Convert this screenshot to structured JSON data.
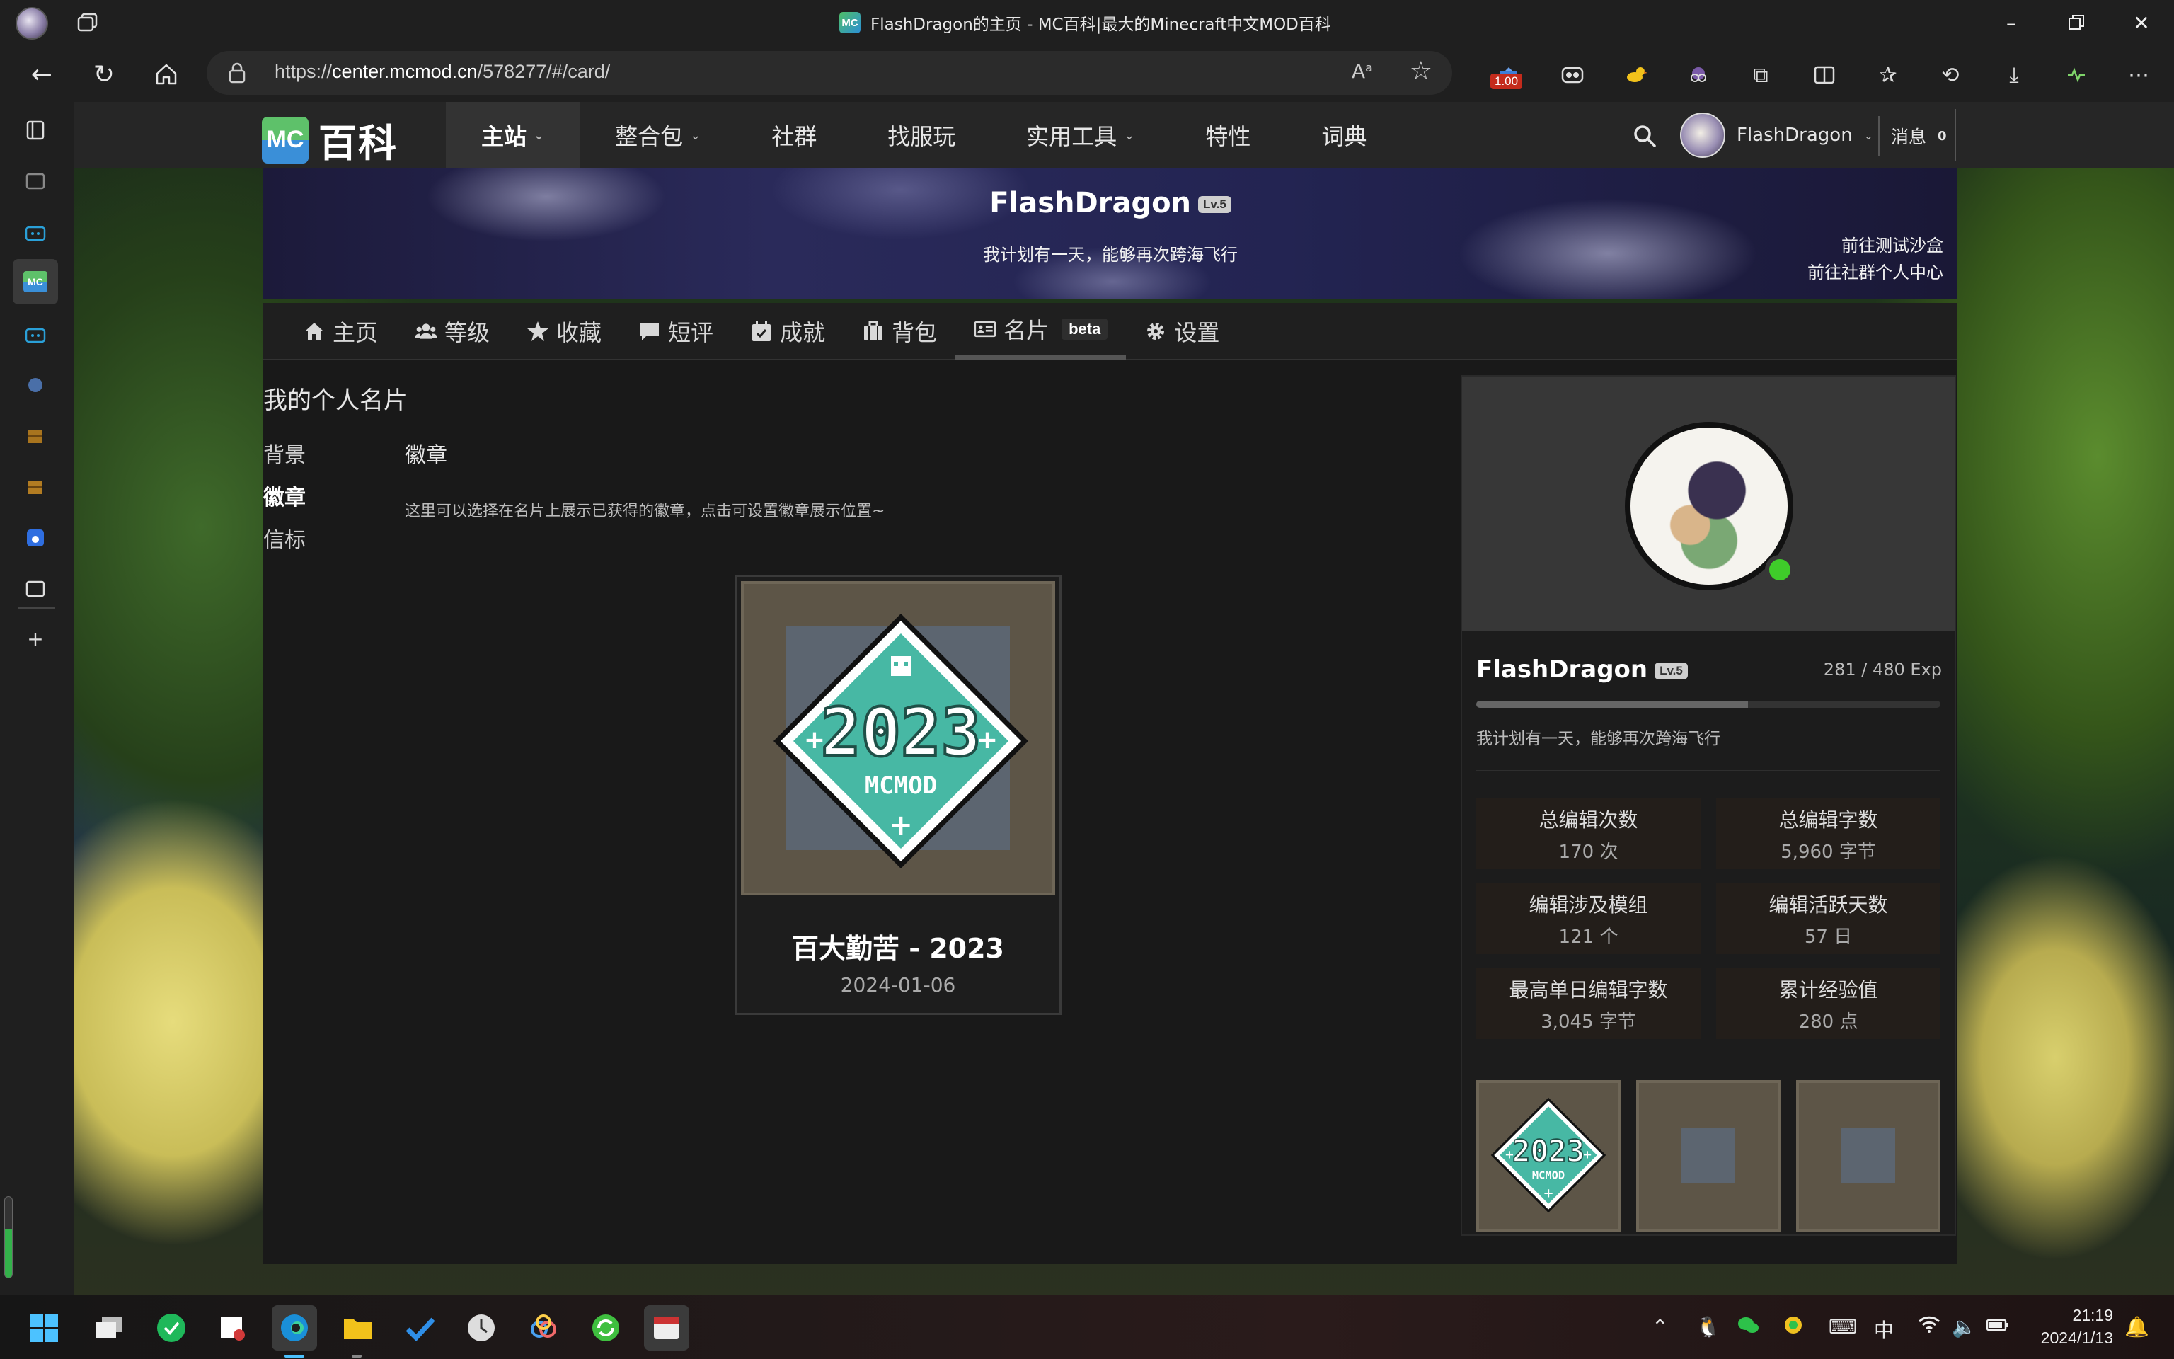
{
  "browser": {
    "tab_title": "FlashDragon的主页 - MC百科|最大的Minecraft中文MOD百科",
    "favicon_text": "MC",
    "url_prefix": "https://",
    "url_host": "center.mcmod.cn",
    "url_path": "/578277/#/card/",
    "ext_badge": "1.00",
    "read_aloud": "A",
    "icons": [
      "back-icon",
      "refresh-icon",
      "home-icon",
      "lock-icon",
      "read-aloud-icon",
      "favorite-star-icon",
      "split-screen-icon",
      "favorites-icon",
      "history-icon",
      "downloads-icon",
      "performance-icon",
      "more-icon"
    ]
  },
  "site": {
    "logo_mc": "MC",
    "logo_text": "百科",
    "nav": [
      {
        "label": "主站",
        "dropdown": true,
        "active": true
      },
      {
        "label": "整合包",
        "dropdown": true
      },
      {
        "label": "社群",
        "dropdown": false
      },
      {
        "label": "找服玩",
        "dropdown": false
      },
      {
        "label": "实用工具",
        "dropdown": true
      },
      {
        "label": "特性",
        "dropdown": false
      },
      {
        "label": "词典",
        "dropdown": false
      }
    ],
    "user_name": "FlashDragon",
    "msg_label": "消息",
    "msg_count": "0"
  },
  "banner": {
    "user_name": "FlashDragon",
    "level": "Lv.5",
    "signature": "我计划有一天，能够再次跨海飞行",
    "link_sandbox": "前往测试沙盒",
    "link_center": "前往社群个人中心"
  },
  "tabs": [
    {
      "label": "主页",
      "icon": "home-icon"
    },
    {
      "label": "等级",
      "icon": "users-icon"
    },
    {
      "label": "收藏",
      "icon": "star-icon"
    },
    {
      "label": "短评",
      "icon": "comment-icon"
    },
    {
      "label": "成就",
      "icon": "calendar-check-icon"
    },
    {
      "label": "背包",
      "icon": "bag-icon"
    },
    {
      "label": "名片",
      "icon": "id-card-icon",
      "active": true,
      "badge": "beta"
    },
    {
      "label": "设置",
      "icon": "gear-icon"
    }
  ],
  "card_page": {
    "title": "我的个人名片",
    "sections": [
      "背景",
      "徽章",
      "信标"
    ],
    "active_section": "徽章",
    "section_heading": "徽章",
    "section_desc": "这里可以选择在名片上展示已获得的徽章，点击可设置徽章展示位置~",
    "badge": {
      "title": "百大勤苦 - 2023",
      "date": "2024-01-06",
      "art_year": "2023",
      "art_text": "MCMOD"
    }
  },
  "profile_card": {
    "name": "FlashDragon",
    "level": "Lv.5",
    "exp_text": "281 / 480 Exp",
    "exp_current": 281,
    "exp_max": 480,
    "signature": "我计划有一天，能够再次跨海飞行",
    "online": true,
    "stats": [
      {
        "label": "总编辑次数",
        "value": "170 次"
      },
      {
        "label": "总编辑字数",
        "value": "5,960 字节"
      },
      {
        "label": "编辑涉及模组",
        "value": "121 个"
      },
      {
        "label": "编辑活跃天数",
        "value": "57 日"
      },
      {
        "label": "最高单日编辑字数",
        "value": "3,045 字节"
      },
      {
        "label": "累计经验值",
        "value": "280 点"
      }
    ],
    "slots": [
      "badge-2023",
      "empty",
      "empty"
    ]
  },
  "taskbar": {
    "apps": [
      "start-icon",
      "task-view-icon",
      "wechat-work-icon",
      "snipping-icon",
      "edge-icon",
      "file-explorer-icon",
      "todo-icon",
      "clock-app-icon",
      "baidu-netdisk-icon",
      "update-icon",
      "video-app-icon"
    ],
    "ime": "中",
    "time": "21:19",
    "date": "2024/1/13"
  },
  "colors": {
    "accent_green": "#3fcc2a",
    "badge_teal": "#47b8a4",
    "nav_bg": "#262626",
    "panel_bg": "#191919"
  }
}
